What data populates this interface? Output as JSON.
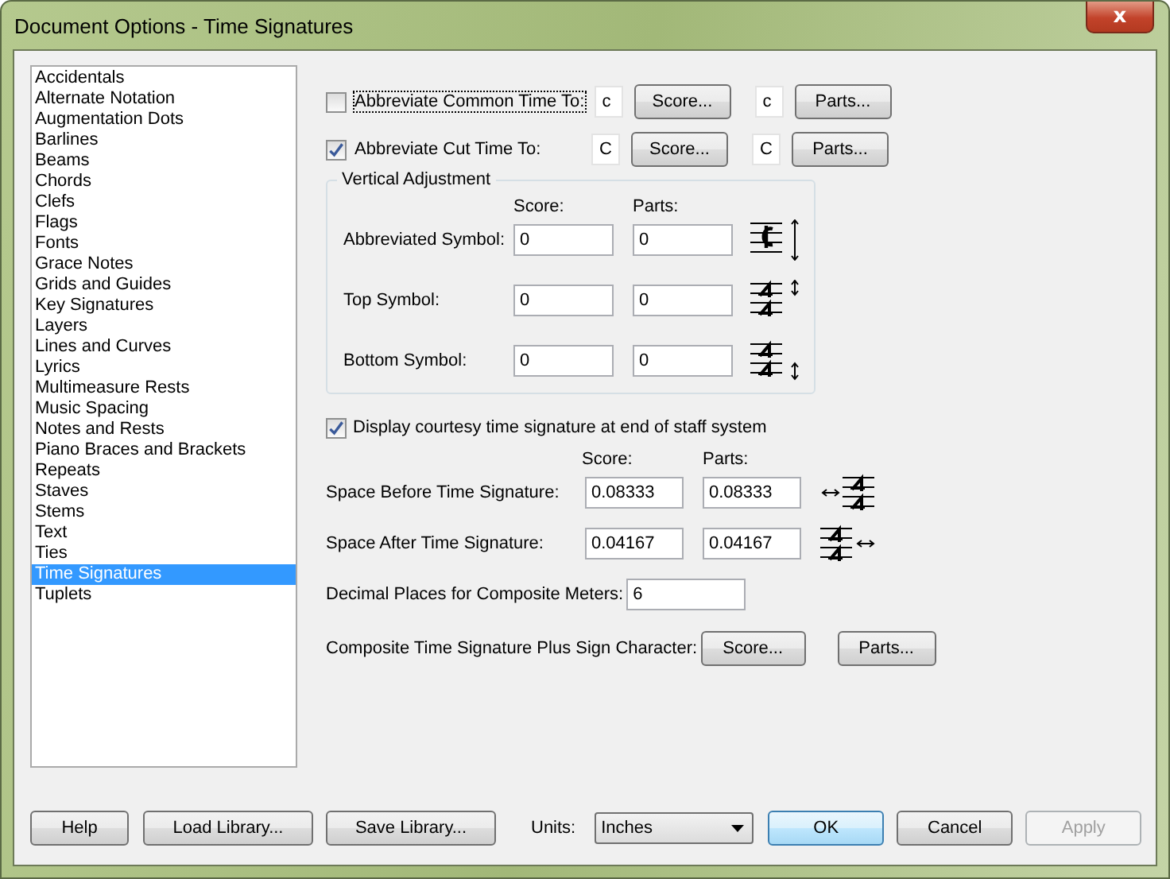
{
  "window": {
    "title": "Document Options - Time Signatures",
    "close": "x"
  },
  "categories": [
    {
      "label": "Accidentals",
      "selected": false
    },
    {
      "label": "Alternate Notation",
      "selected": false
    },
    {
      "label": "Augmentation Dots",
      "selected": false
    },
    {
      "label": "Barlines",
      "selected": false
    },
    {
      "label": "Beams",
      "selected": false
    },
    {
      "label": "Chords",
      "selected": false
    },
    {
      "label": "Clefs",
      "selected": false
    },
    {
      "label": "Flags",
      "selected": false
    },
    {
      "label": "Fonts",
      "selected": false
    },
    {
      "label": "Grace Notes",
      "selected": false
    },
    {
      "label": "Grids and Guides",
      "selected": false
    },
    {
      "label": "Key Signatures",
      "selected": false
    },
    {
      "label": "Layers",
      "selected": false
    },
    {
      "label": "Lines and Curves",
      "selected": false
    },
    {
      "label": "Lyrics",
      "selected": false
    },
    {
      "label": "Multimeasure Rests",
      "selected": false
    },
    {
      "label": "Music Spacing",
      "selected": false
    },
    {
      "label": "Notes and Rests",
      "selected": false
    },
    {
      "label": "Piano Braces and Brackets",
      "selected": false
    },
    {
      "label": "Repeats",
      "selected": false
    },
    {
      "label": "Staves",
      "selected": false
    },
    {
      "label": "Stems",
      "selected": false
    },
    {
      "label": "Text",
      "selected": false
    },
    {
      "label": "Ties",
      "selected": false
    },
    {
      "label": "Time Signatures",
      "selected": true
    },
    {
      "label": "Tuplets",
      "selected": false
    }
  ],
  "abbreviations": [
    {
      "label": "Abbreviate Common Time To:",
      "checked": false,
      "score_symbol": "c",
      "score_button": "Score...",
      "parts_symbol": "c",
      "parts_button": "Parts..."
    },
    {
      "label": "Abbreviate Cut Time To:",
      "checked": true,
      "score_symbol": "C",
      "score_button": "Score...",
      "parts_symbol": "C",
      "parts_button": "Parts..."
    }
  ],
  "vertical_adjustment": {
    "title": "Vertical Adjustment",
    "score_header": "Score:",
    "parts_header": "Parts:",
    "rows": [
      {
        "label": "Abbreviated Symbol:",
        "score": "0",
        "parts": "0",
        "kind": "common"
      },
      {
        "label": "Top Symbol:",
        "score": "0",
        "parts": "0",
        "kind": "top"
      },
      {
        "label": "Bottom Symbol:",
        "score": "0",
        "parts": "0",
        "kind": "bottom"
      }
    ]
  },
  "courtesy": {
    "label": "Display courtesy time signature at end of staff system",
    "checked": true
  },
  "spacing": {
    "score_header": "Score:",
    "parts_header": "Parts:",
    "rows": [
      {
        "label": "Space Before Time Signature:",
        "score": "0.08333",
        "parts": "0.08333",
        "kind": "before"
      },
      {
        "label": "Space After Time Signature:",
        "score": "0.04167",
        "parts": "0.04167",
        "kind": "after"
      }
    ]
  },
  "decimal_places": {
    "label": "Decimal Places for Composite Meters:",
    "value": "6"
  },
  "plus_sign": {
    "label": "Composite Time Signature Plus Sign Character:",
    "score_button": "Score...",
    "parts_button": "Parts..."
  },
  "footer": {
    "help": "Help",
    "load": "Load Library...",
    "save": "Save Library...",
    "units_label": "Units:",
    "units_value": "Inches",
    "ok": "OK",
    "cancel": "Cancel",
    "apply": {
      "label": "Apply",
      "disabled": true
    }
  }
}
